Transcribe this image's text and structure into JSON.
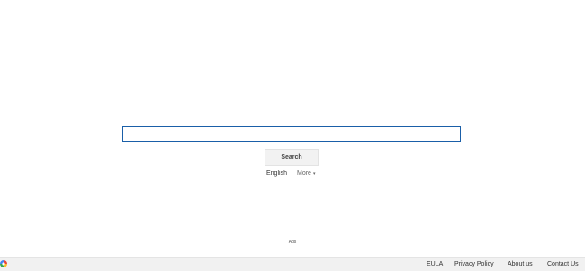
{
  "search": {
    "value": "",
    "placeholder": "",
    "button_label": "Search"
  },
  "language": {
    "current": "English",
    "more_label": "More",
    "more_caret": "▾"
  },
  "ads_label": "Ads",
  "footer": {
    "logo_icon": "colorful-circle-logo",
    "links": [
      "EULA",
      "Privacy Policy",
      "About us",
      "Contact Us"
    ]
  },
  "colors": {
    "search_border": "#1a5fa8",
    "footer_background": "#f1f1f1",
    "button_background": "#f2f2f2"
  }
}
